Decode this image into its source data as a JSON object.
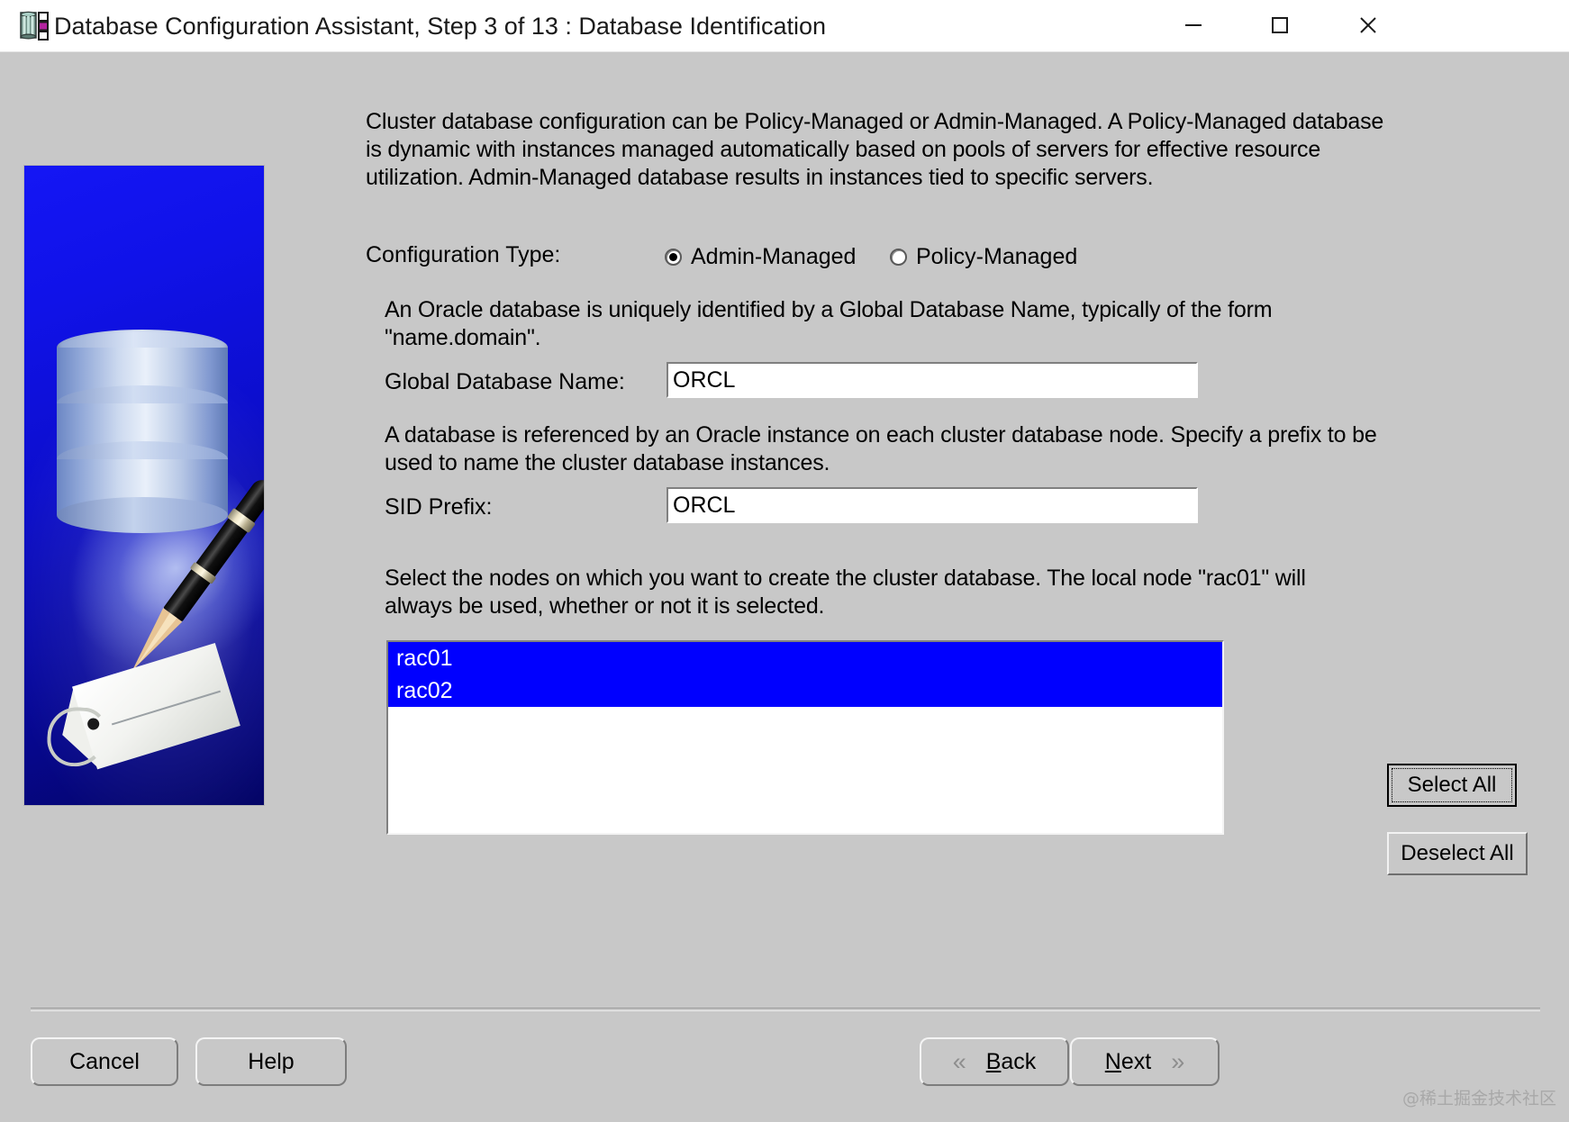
{
  "window": {
    "title": "Database Configuration Assistant, Step 3 of 13 : Database Identification",
    "icon": "database-app-icon",
    "controls": {
      "minimize": "—",
      "maximize": "□",
      "close": "✕"
    }
  },
  "banner": {
    "alt": "oracle-database-pen-tag-illustration"
  },
  "main": {
    "intro_text": "Cluster database configuration can be Policy-Managed or Admin-Managed. A Policy-Managed database is dynamic with instances managed automatically based on pools of servers for effective resource utilization. Admin-Managed database results in instances tied to specific servers.",
    "config_type": {
      "label": "Configuration Type:",
      "options": [
        {
          "label": "Admin-Managed",
          "selected": true
        },
        {
          "label": "Policy-Managed",
          "selected": false
        }
      ]
    },
    "global_db": {
      "help_text": "An Oracle database is uniquely identified by a Global Database Name, typically of the form \"name.domain\".",
      "label": "Global Database Name:",
      "value": "ORCL",
      "placeholder": ""
    },
    "sid_prefix": {
      "help_text": "A database is referenced by an Oracle instance on each cluster database node. Specify a prefix to be used to name the cluster database instances.",
      "label": "SID Prefix:",
      "value": "ORCL",
      "placeholder": ""
    },
    "nodes": {
      "help_text": "Select the nodes on which you want to create the cluster database. The local node \"rac01\" will always be used, whether or not it is selected.",
      "items": [
        {
          "name": "rac01",
          "selected": true
        },
        {
          "name": "rac02",
          "selected": true
        }
      ],
      "select_all_label": "Select All",
      "deselect_all_label": "Deselect All"
    }
  },
  "footer": {
    "cancel_label": "Cancel",
    "help_label": "Help",
    "back": {
      "mnemonic": "B",
      "rest": "ack",
      "chevron": "«"
    },
    "next": {
      "mnemonic": "N",
      "rest": "ext",
      "chevron": "»"
    }
  },
  "watermark": "@稀土掘金技术社区",
  "colors": {
    "window_bg": "#c8c8c8",
    "titlebar_bg": "#ffffff",
    "selection_blue": "#0000ff",
    "banner_blue": "#0c0ecd",
    "text": "#000000"
  }
}
